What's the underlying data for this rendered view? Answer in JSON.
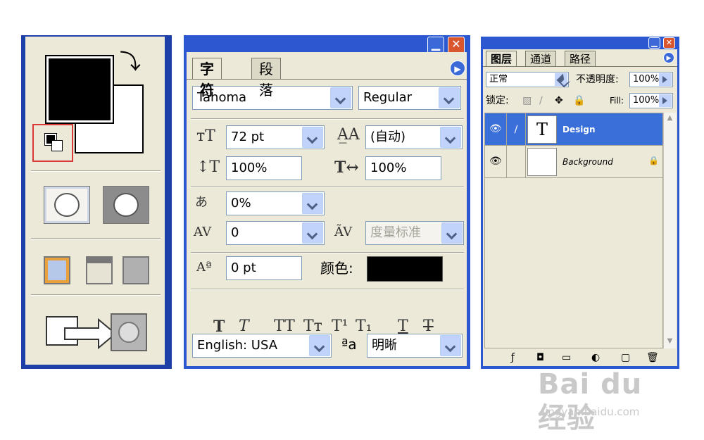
{
  "tools": {
    "icons": {
      "swap": "swap-colors-icon",
      "default": "default-colors-icon",
      "standard_mode": "standard-mode-icon",
      "quick_mask": "quick-mask-icon",
      "screen_std": "standard-screen-icon",
      "screen_menu": "full-screen-menu-icon",
      "screen_full": "full-screen-icon",
      "jump": "jump-to-imageready-icon"
    },
    "colors": {
      "foreground": "#000000",
      "background": "#ffffff",
      "highlight": "#d83a3a"
    }
  },
  "character": {
    "tabs": [
      {
        "label": "字符"
      },
      {
        "label": "段落"
      }
    ],
    "font_family": "Tahoma",
    "font_style": "Regular",
    "font_size": "72 pt",
    "leading": "(自动)",
    "vertical_scale": "100%",
    "horizontal_scale": "100%",
    "tsume": "0%",
    "kerning": "0",
    "tracking": "度量标准",
    "baseline_shift": "0 pt",
    "color_label": "颜色:",
    "color_value": "#000000",
    "styles": [
      "T",
      "T",
      "TT",
      "Tт",
      "T¹",
      "T₁",
      "T",
      "T"
    ],
    "language": "English: USA",
    "antialias_label": "ªa",
    "antialias": "明晰"
  },
  "layers": {
    "tabs": [
      {
        "label": "图层"
      },
      {
        "label": "通道"
      },
      {
        "label": "路径"
      }
    ],
    "blend_mode": "正常",
    "opacity_label": "不透明度:",
    "opacity": "100%",
    "lock_label": "锁定:",
    "fill_label": "Fill:",
    "fill": "100%",
    "items": [
      {
        "name": "Design",
        "thumb": "T",
        "selected": true
      },
      {
        "name": "Background",
        "thumb": "",
        "selected": false
      }
    ],
    "bottom_icons": [
      "ƒ",
      "◘",
      "▭",
      "◐",
      "▢",
      "🗑"
    ]
  },
  "watermark": {
    "main": "Bai du 经验",
    "url": "jingyan.baidu.com"
  }
}
